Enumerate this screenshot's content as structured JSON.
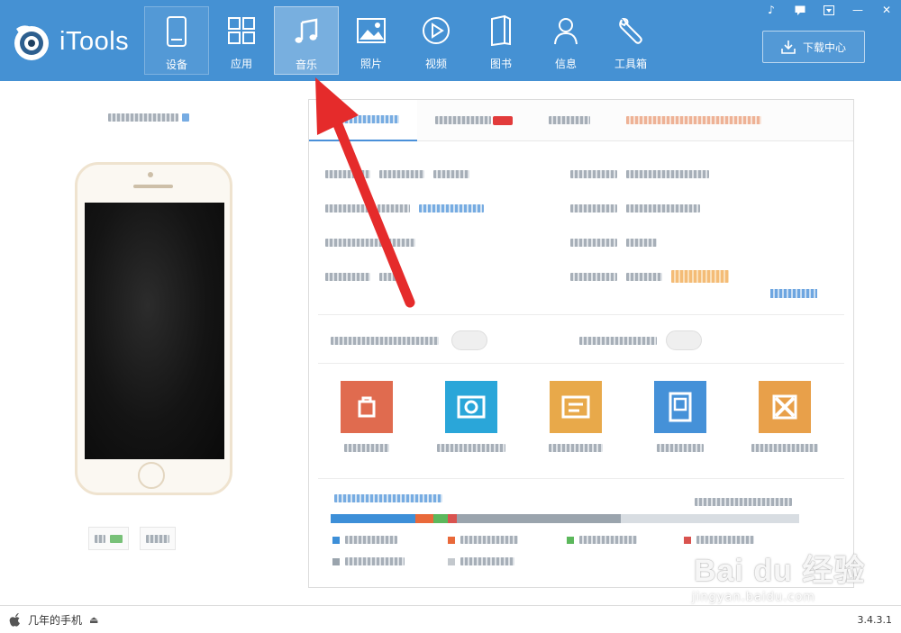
{
  "app": {
    "logo_text": "iTools"
  },
  "nav": [
    {
      "label": "设备",
      "icon": "phone-icon"
    },
    {
      "label": "应用",
      "icon": "apps-grid-icon"
    },
    {
      "label": "音乐",
      "icon": "music-note-icon"
    },
    {
      "label": "照片",
      "icon": "picture-icon"
    },
    {
      "label": "视频",
      "icon": "play-icon"
    },
    {
      "label": "图书",
      "icon": "book-icon"
    },
    {
      "label": "信息",
      "icon": "user-icon"
    },
    {
      "label": "工具箱",
      "icon": "wrench-icon"
    }
  ],
  "nav_active_index": 2,
  "window_controls": [
    "music-icon",
    "chat-icon",
    "dropdown-icon",
    "minimize-icon",
    "close-icon"
  ],
  "download_center": {
    "label": "下载中心",
    "icon": "download-icon"
  },
  "status": {
    "device_name": "几年的手机",
    "version": "3.4.3.1"
  },
  "watermark": {
    "main": "Bai du 经验",
    "sub": "jingyan.baidu.com"
  },
  "colors": {
    "header_bg": "#4591d3",
    "accent": "#4a90d9",
    "annotation_arrow": "#e52b2b",
    "storage_segments": [
      "#3d8fd8",
      "#e9693a",
      "#5cb85c",
      "#d9534f",
      "#9aa4ad"
    ]
  },
  "storage_fractions": [
    0.18,
    0.04,
    0.03,
    0.02,
    0.35
  ]
}
